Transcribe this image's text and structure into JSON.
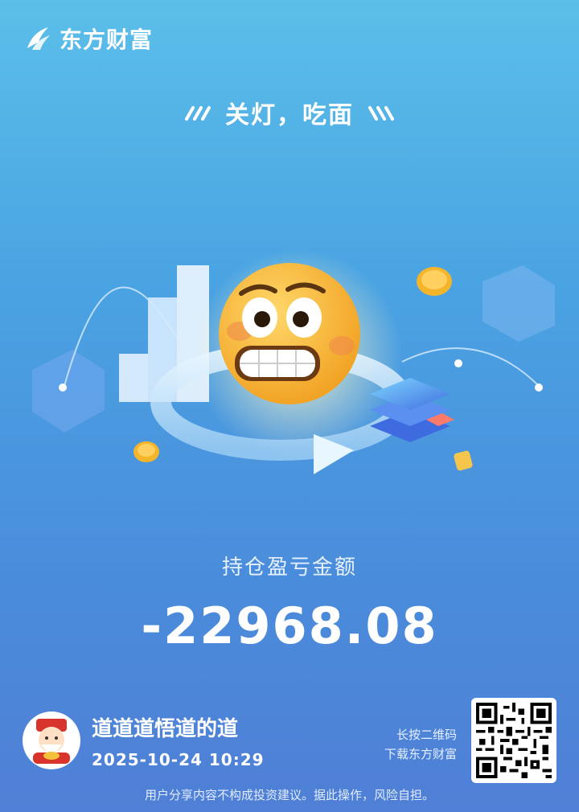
{
  "brand": {
    "name": "东方财富",
    "logo_icon": "eastmoney-logo-icon"
  },
  "slogan": {
    "text": "关灯，吃面"
  },
  "hero": {
    "illustration": "grimacing-emoji-icon"
  },
  "pnl": {
    "label": "持仓盈亏金额",
    "value": "-22968.08"
  },
  "user": {
    "name": "道道道悟道的道",
    "timestamp": "2025-10-24 10:29",
    "avatar_icon": "caishen-avatar-icon"
  },
  "qr": {
    "hint_line1": "长按二维码",
    "hint_line2": "下载东方财富",
    "icon": "qr-code-icon"
  },
  "footer": {
    "disclaimer": "用户分享内容不构成投资建议。据此操作，风险自担。"
  },
  "colors": {
    "bg_top": "#5bbfe9",
    "bg_bottom": "#4f7fd6",
    "emoji": "#f7b733"
  }
}
